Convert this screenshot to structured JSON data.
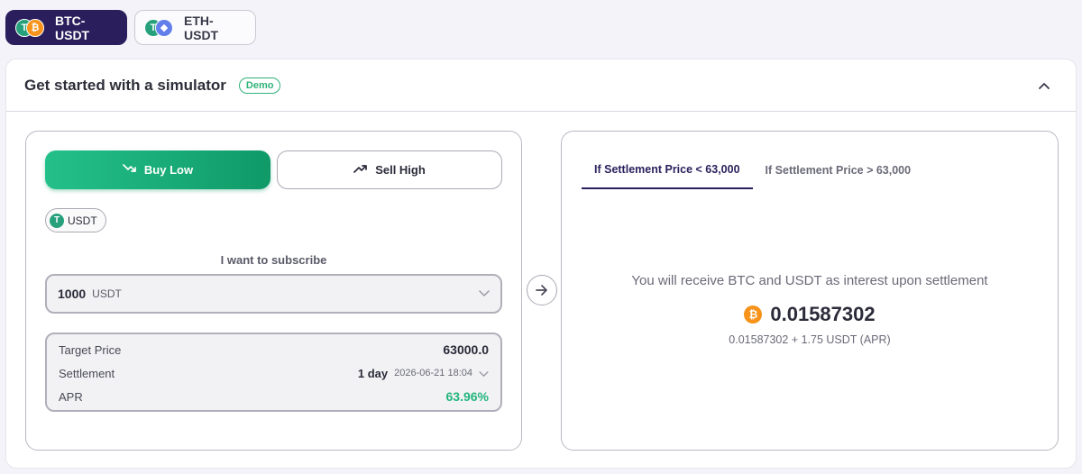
{
  "pair_tabs": [
    {
      "label": "BTC-USDT",
      "active": true,
      "icons": [
        "usdt-icon",
        "btc-icon"
      ]
    },
    {
      "label": "ETH-USDT",
      "active": false,
      "icons": [
        "usdt-icon",
        "eth-icon"
      ]
    }
  ],
  "simulator": {
    "title": "Get started with a simulator",
    "badge": "Demo",
    "collapse_icon": "chevron-up-icon"
  },
  "direction": {
    "buy_label": "Buy Low",
    "buy_icon": "trend-down-icon",
    "sell_label": "Sell High",
    "sell_icon": "trend-up-icon",
    "selected": "buy"
  },
  "currency_chip": {
    "label": "USDT",
    "icon": "usdt-icon"
  },
  "subscribe": {
    "label": "I want to subscribe",
    "amount": "1000",
    "unit": "USDT"
  },
  "details": {
    "target_price_label": "Target Price",
    "target_price_value": "63000.0",
    "settlement_label": "Settlement",
    "settlement_days": "1 day",
    "settlement_date": "2026-06-21 18:04",
    "apr_label": "APR",
    "apr_value": "63.96%"
  },
  "result": {
    "tabs": [
      {
        "label": "If Settlement Price < 63,000",
        "active": true
      },
      {
        "label": "If Settlement Price > 63,000",
        "active": false
      }
    ],
    "message": "You will receive BTC and USDT as interest upon settlement",
    "amount": "0.01587302",
    "amount_icon": "btc-icon",
    "breakdown": "0.01587302 + 1.75 USDT (APR)"
  },
  "colors": {
    "accent_dark": "#2a1f5c",
    "buy_green": "#1aad79",
    "apr_green": "#23b57c",
    "btc_orange": "#f7931a",
    "usdt_green": "#26a17b",
    "eth_blue": "#627eea"
  }
}
